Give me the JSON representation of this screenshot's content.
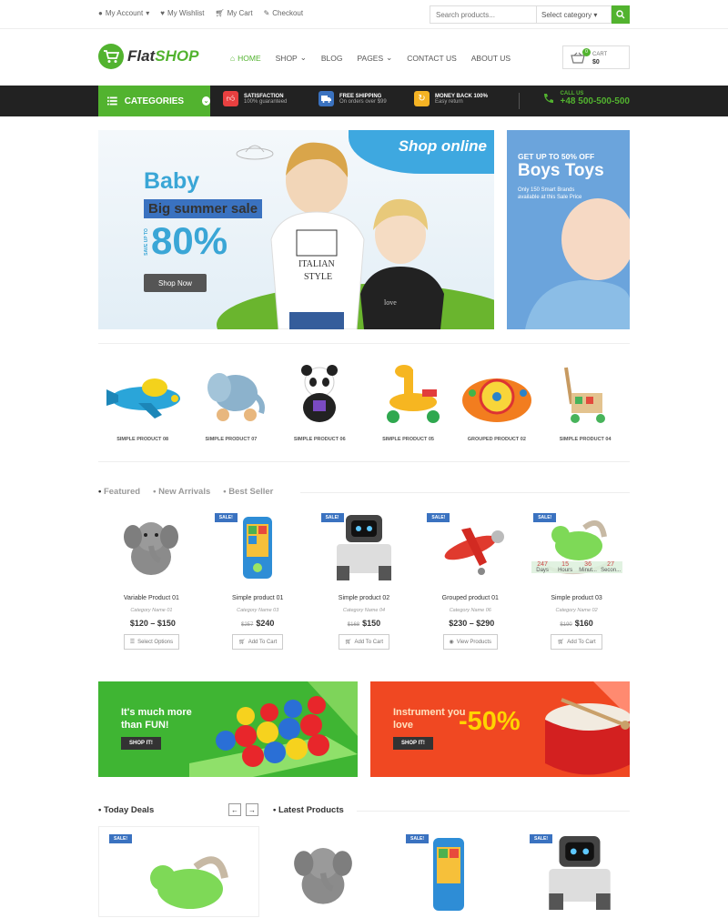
{
  "topbar": {
    "account": "My Account",
    "wishlist": "My Wishlist",
    "cart": "My Cart",
    "checkout": "Checkout",
    "search_placeholder": "Search products...",
    "category_select": "Select category"
  },
  "header": {
    "logo_flat": "Flat",
    "logo_shop": "SHOP",
    "nav": [
      "HOME",
      "SHOP",
      "BLOG",
      "PAGES",
      "CONTACT US",
      "ABOUT US"
    ],
    "cart_label": "CART",
    "cart_amount": "$0",
    "cart_count": "0"
  },
  "bar": {
    "categories": "CATEGORIES",
    "features": [
      {
        "title": "SATISFACTION",
        "sub": "100% guaranteed",
        "color": "#e84040"
      },
      {
        "title": "FREE SHIPPING",
        "sub": "On orders over $99",
        "color": "#3a72c0"
      },
      {
        "title": "MONEY BACK 100%",
        "sub": "Easy return",
        "color": "#f5b324"
      }
    ],
    "call_label": "CALL US",
    "phone": "+48 500-500-500"
  },
  "hero": {
    "baby": "Baby",
    "sale": "Big summer sale",
    "save": "SAVE UP TO",
    "percent": "80%",
    "button": "Shop Now",
    "online": "Shop online",
    "side_t1": "GET UP TO 50% OFF",
    "side_t2": "Boys Toys",
    "side_t3": "Only 150 Smart Brands available at this Sale Price"
  },
  "toys": [
    "SIMPLE PRODUCT 08",
    "SIMPLE PRODUCT 07",
    "SIMPLE PRODUCT 06",
    "SIMPLE PRODUCT 05",
    "GROUPED PRODUCT 02",
    "SIMPLE PRODUCT 04"
  ],
  "tabs": [
    "Featured",
    "New Arrivals",
    "Best Seller"
  ],
  "products": [
    {
      "name": "Variable Product 01",
      "cat": "Category Name 01",
      "old": "",
      "price": "$120 – $150",
      "btn": "Select Options",
      "sale": ""
    },
    {
      "name": "Simple product 01",
      "cat": "Category Name 03",
      "old": "$257",
      "price": "$240",
      "btn": "Add To Cart",
      "sale": "SALE!"
    },
    {
      "name": "Simple product 02",
      "cat": "Category Name 04",
      "old": "$168",
      "price": "$150",
      "btn": "Add To Cart",
      "sale": "SALE!"
    },
    {
      "name": "Grouped product 01",
      "cat": "Category Name 06",
      "old": "",
      "price": "$230 – $290",
      "btn": "View Products",
      "sale": "SALE!"
    },
    {
      "name": "Simple product 03",
      "cat": "Category Name 02",
      "old": "$190",
      "price": "$160",
      "btn": "Add To Cart",
      "sale": "SALE!"
    }
  ],
  "countdown": [
    {
      "n": "247",
      "u": "Days"
    },
    {
      "n": "15",
      "u": "Hours"
    },
    {
      "n": "36",
      "u": "Minut..."
    },
    {
      "n": "27",
      "u": "Secon..."
    }
  ],
  "banners": {
    "b1_text": "It's much more than FUN!",
    "b1_btn": "SHOP IT!",
    "b2_text": "Instrument you love",
    "b2_big": "-50%",
    "b2_btn": "SHOP IT!"
  },
  "bottom": {
    "deals": "Today Deals",
    "latest": "Latest Products",
    "sale": "SALE!",
    "prev": "←",
    "next": "→"
  }
}
